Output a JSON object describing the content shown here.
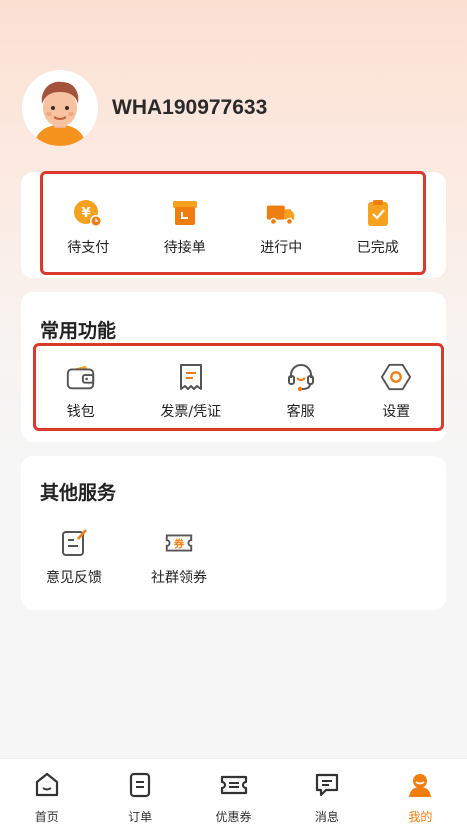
{
  "profile": {
    "username": "WHA190977633"
  },
  "orders": {
    "items": [
      {
        "label": "待支付",
        "icon": "pending-payment-icon"
      },
      {
        "label": "待接单",
        "icon": "pending-accept-icon"
      },
      {
        "label": "进行中",
        "icon": "truck-icon"
      },
      {
        "label": "已完成",
        "icon": "clipboard-check-icon"
      }
    ]
  },
  "common": {
    "title": "常用功能",
    "items": [
      {
        "label": "钱包",
        "icon": "wallet-icon"
      },
      {
        "label": "发票/凭证",
        "icon": "receipt-icon"
      },
      {
        "label": "客服",
        "icon": "headset-icon"
      },
      {
        "label": "设置",
        "icon": "gear-icon"
      }
    ]
  },
  "other": {
    "title": "其他服务",
    "items": [
      {
        "label": "意见反馈",
        "icon": "feedback-icon"
      },
      {
        "label": "社群领券",
        "icon": "coupon-ticket-icon"
      }
    ],
    "coupon_glyph": "券"
  },
  "tabbar": {
    "items": [
      {
        "label": "首页",
        "icon": "home-icon"
      },
      {
        "label": "订单",
        "icon": "order-icon"
      },
      {
        "label": "优惠券",
        "icon": "coupon-icon"
      },
      {
        "label": "消息",
        "icon": "message-icon"
      },
      {
        "label": "我的",
        "icon": "profile-icon"
      }
    ],
    "active_index": 4
  },
  "colors": {
    "accent": "#f07d10",
    "highlight_box": "#d93a2c"
  }
}
